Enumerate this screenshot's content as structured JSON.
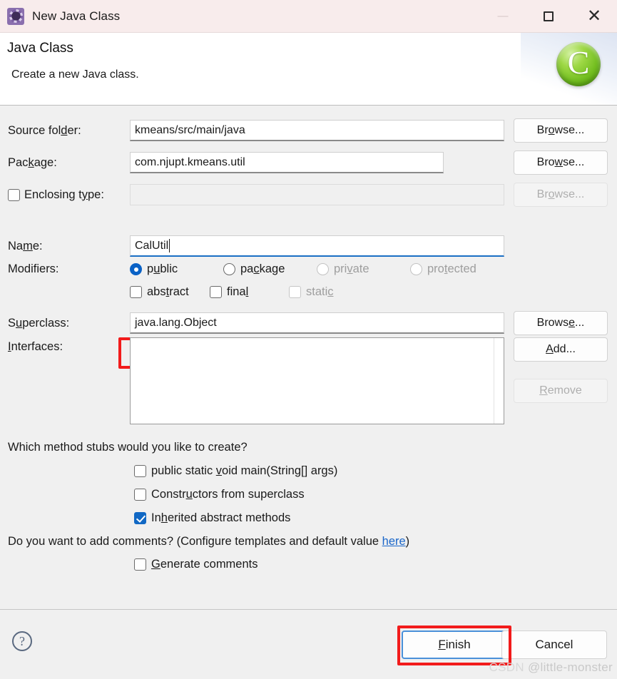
{
  "window": {
    "title": "New Java Class",
    "icon": "java-class-wizard-icon",
    "controls": {
      "minimize": "—",
      "maximize": "maximize-icon",
      "close": "✕"
    }
  },
  "header": {
    "title": "Java Class",
    "subtitle": "Create a new Java class.",
    "logo": "C"
  },
  "form": {
    "source_folder": {
      "label_a": "Source fol",
      "label_mn": "d",
      "label_b": "er:",
      "value": "kmeans/src/main/java",
      "browse_a": "Br",
      "browse_mn": "o",
      "browse_b": "wse..."
    },
    "package": {
      "label_a": "Pac",
      "label_mn": "k",
      "label_b": "age:",
      "value": "com.njupt.kmeans.util",
      "browse_a": "Bro",
      "browse_mn": "w",
      "browse_b": "se..."
    },
    "enclosing_type": {
      "label_a": "Enclosing t",
      "label_mn": "y",
      "label_b": "pe:",
      "value": "",
      "checked": false,
      "browse_a": "Br",
      "browse_mn": "o",
      "browse_b": "wse...",
      "disabled": true
    },
    "name": {
      "label_a": "Na",
      "label_mn": "m",
      "label_b": "e:",
      "value": "CalUtil",
      "focused": true,
      "highlighted": true
    },
    "modifiers": {
      "label": "Modifiers:",
      "radios": [
        {
          "a": "p",
          "mn": "u",
          "b": "blic",
          "selected": true,
          "disabled": false
        },
        {
          "a": "pa",
          "mn": "c",
          "b": "kage",
          "selected": false,
          "disabled": false
        },
        {
          "a": "pri",
          "mn": "v",
          "b": "ate",
          "selected": false,
          "disabled": true
        },
        {
          "a": "pro",
          "mn": "t",
          "b": "ected",
          "selected": false,
          "disabled": true
        }
      ],
      "checkboxes": [
        {
          "a": "abs",
          "mn": "t",
          "b": "ract",
          "checked": false,
          "disabled": false
        },
        {
          "a": "fina",
          "mn": "l",
          "b": "",
          "checked": false,
          "disabled": false
        },
        {
          "a": "stati",
          "mn": "c",
          "b": "",
          "checked": false,
          "disabled": true
        }
      ]
    },
    "superclass": {
      "label_a": "S",
      "label_mn": "u",
      "label_b": "perclass:",
      "value": "java.lang.Object",
      "browse_a": "Brows",
      "browse_mn": "e",
      "browse_b": "..."
    },
    "interfaces": {
      "label_a": "",
      "label_mn": "I",
      "label_b": "nterfaces:",
      "items": [],
      "add_a": "",
      "add_mn": "A",
      "add_b": "dd...",
      "remove_a": "",
      "remove_mn": "R",
      "remove_b": "emove",
      "remove_disabled": true
    },
    "stubs": {
      "question": "Which method stubs would you like to create?",
      "options": [
        {
          "a": "public static ",
          "mn": "v",
          "b": "oid main(String[] args)",
          "checked": false
        },
        {
          "a": "Constr",
          "mn": "u",
          "b": "ctors from superclass",
          "checked": false
        },
        {
          "a": "In",
          "mn": "h",
          "b": "erited abstract methods",
          "checked": true
        }
      ]
    },
    "comments": {
      "question_a": "Do you want to add comments? (Configure templates and default value ",
      "link": "here",
      "question_b": ")",
      "option": {
        "a": "",
        "mn": "G",
        "b": "enerate comments",
        "checked": false
      }
    }
  },
  "footer": {
    "help": "?",
    "finish_a": "",
    "finish_mn": "F",
    "finish_b": "inish",
    "finish_highlighted": true,
    "cancel": "Cancel"
  },
  "watermark": {
    "brand": "CSDN",
    "user": "@little-monster"
  },
  "colors": {
    "accent_blue": "#0a62c6",
    "link_blue": "#1a66c9",
    "highlight_red": "#f21b1b",
    "titlebar": "#f8ecec",
    "dialog_bg": "#f0f0f0"
  }
}
